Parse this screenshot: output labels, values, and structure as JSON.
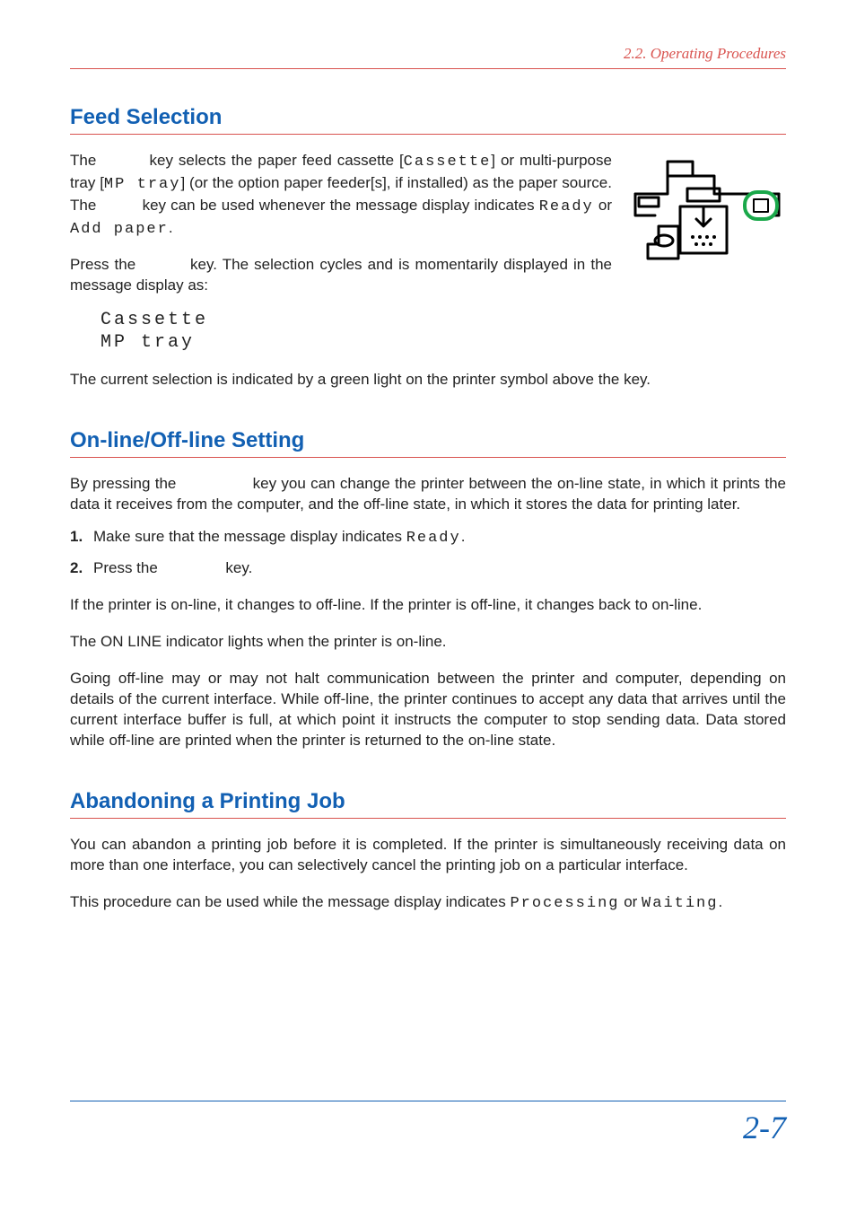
{
  "header": {
    "running_title": "2.2. Operating Procedures"
  },
  "feed": {
    "title": "Feed Selection",
    "p1a": "The ",
    "p1b": " key selects the paper feed cassette [",
    "code_cassette": "Cassette",
    "p1c": "] or multi-purpose tray [",
    "code_mptray": "MP tray",
    "p1d": "] (or the option paper feeder[s], if installed) as the paper source. The ",
    "p1e": " key can be used whenever the message display indicates ",
    "code_ready": "Ready",
    "p1f": " or ",
    "code_addpaper": "Add paper",
    "p1g": ".",
    "p2a": "Press the ",
    "p2b": " key. The selection cycles and is momentarily displayed in the message display as:",
    "cycle": "Cassette\nMP tray",
    "p3": "The current selection is indicated by a green light on the printer symbol above the key."
  },
  "online": {
    "title": "On-line/Off-line Setting",
    "p1a": "By pressing the ",
    "p1b": " key you can change the printer between the on-line state, in which it prints the data it receives from the computer, and the off-line state, in which it stores the data for printing later.",
    "step1a": "Make sure that the message display indicates ",
    "step1_code": "Ready",
    "step1b": ".",
    "step2a": "Press the ",
    "step2b": " key.",
    "p2": "If the printer is on-line, it changes to off-line. If the printer is off-line, it changes back to on-line.",
    "p3": "The ON LINE indicator lights when the printer is on-line.",
    "p4": "Going off-line may or may not halt communication between the printer and computer, depending on details of the current interface. While off-line, the printer continues to accept any data that arrives until the current interface buffer is full, at which point it instructs the computer to stop sending data. Data stored while off-line are printed when the printer is returned to the on-line state."
  },
  "abandon": {
    "title": "Abandoning a Printing Job",
    "p1": "You can abandon a printing job before it is completed. If the printer is simultaneously receiving data on more than one interface, you can selectively cancel the printing job on a particular interface.",
    "p2a": "This procedure can be used while the message display indicates ",
    "code_processing": "Processing",
    "p2b": " or ",
    "code_waiting": "Waiting",
    "p2c": "."
  },
  "page_number": "2-7"
}
